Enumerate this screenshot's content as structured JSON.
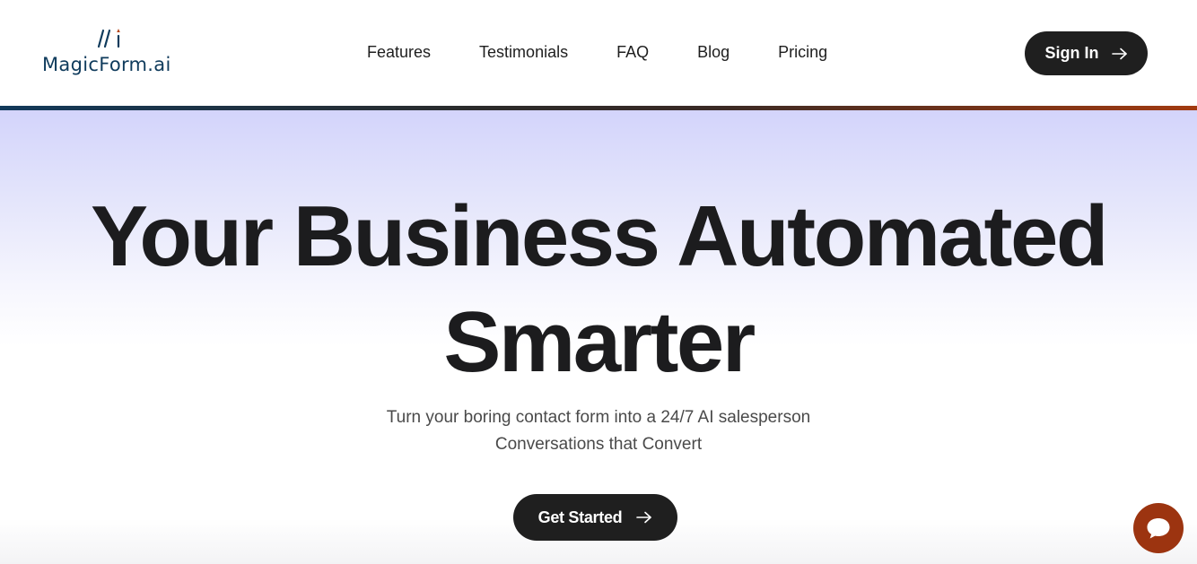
{
  "brand": {
    "name": "MagicForm.ai",
    "logo_icon": "slash-i-logo-icon",
    "color": "#0f3b5c"
  },
  "nav": {
    "items": [
      {
        "label": "Features"
      },
      {
        "label": "Testimonials"
      },
      {
        "label": "FAQ"
      },
      {
        "label": "Blog"
      },
      {
        "label": "Pricing"
      }
    ],
    "sign_in_label": "Sign In",
    "sign_in_icon": "arrow-right-icon"
  },
  "hero": {
    "headline_line1": "Your Business Automated",
    "headline_line2": "Smarter",
    "subline1": "Turn your boring contact form into a 24/7 AI salesperson",
    "subline2": "Conversations that Convert",
    "cta_label": "Get Started",
    "cta_icon": "arrow-right-icon"
  },
  "chat": {
    "icon": "chat-bubble-icon",
    "color": "#9c3410"
  },
  "colors": {
    "button_bg": "#1f1f1f",
    "hero_gradient_top": "#d3d4fb",
    "accent_line_start": "#12395a",
    "accent_line_end": "#a23a10"
  }
}
